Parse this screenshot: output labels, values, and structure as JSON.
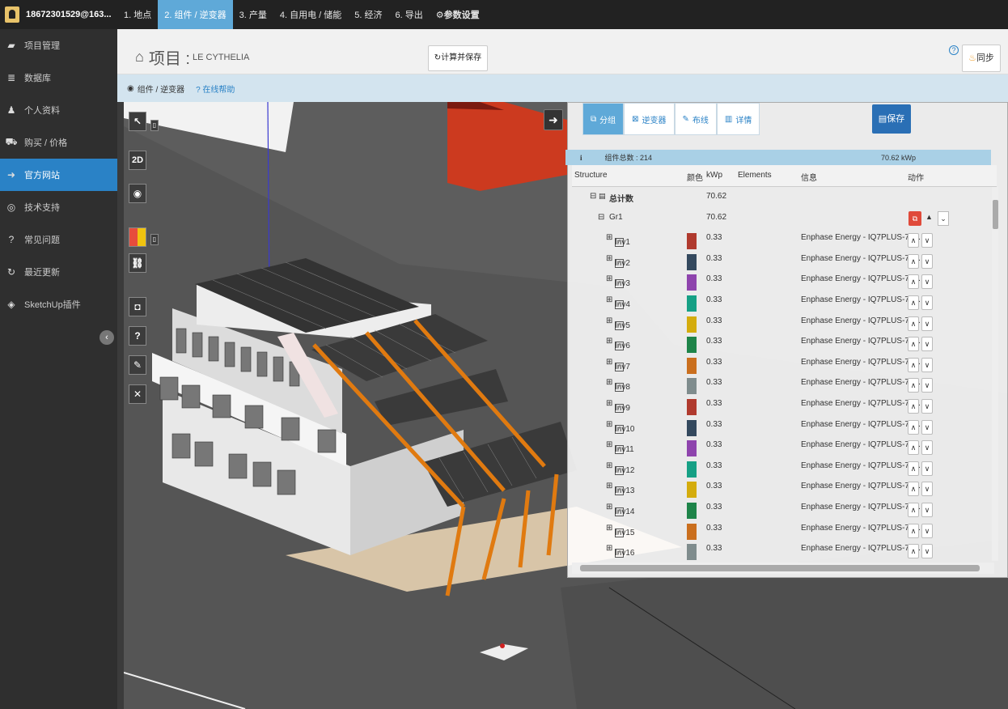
{
  "sidebar": {
    "user": "18672301529@163...",
    "items": [
      {
        "label": "项目管理",
        "icon": "folder-icon",
        "glyph": "▰"
      },
      {
        "label": "数据库",
        "icon": "database-icon",
        "glyph": "≣"
      },
      {
        "label": "个人资料",
        "icon": "user-icon",
        "glyph": "♟"
      },
      {
        "label": "购买 / 价格",
        "icon": "cart-icon",
        "glyph": "⛟"
      },
      {
        "label": "官方网站",
        "icon": "arrow-up-icon",
        "glyph": "➜"
      },
      {
        "label": "技术支持",
        "icon": "lifebuoy-icon",
        "glyph": "◎"
      },
      {
        "label": "常见问题",
        "icon": "question-icon",
        "glyph": "?"
      },
      {
        "label": "最近更新",
        "icon": "refresh-icon",
        "glyph": "↻"
      },
      {
        "label": "SketchUp插件",
        "icon": "sketchup-icon",
        "glyph": "◈"
      }
    ],
    "active_index": 4
  },
  "topnav": {
    "tabs": [
      "1. 地点",
      "2. 组件 / 逆变器",
      "3. 产量",
      "4. 自用电 / 储能",
      "5. 经济",
      "6. 导出",
      "参数设置"
    ],
    "active_index": 1
  },
  "header": {
    "title": "项目 :",
    "project_name": "LE CYTHELIA",
    "calc_button": "计算并保存",
    "help": "?",
    "sync_button": "同步"
  },
  "breadcrumb": {
    "current": "组件 / 逆变器",
    "help_link": "在线帮助"
  },
  "viewer_tools": {
    "two_d": "2D",
    "help": "?"
  },
  "panel": {
    "tabs": [
      "分组",
      "逆变器",
      "布线",
      "详情"
    ],
    "active_tab": 0,
    "save_button": "保存",
    "info": {
      "icon": "i",
      "module_count": "组件总数 : 214",
      "total_power": "70.62 kWp"
    },
    "columns": [
      "Structure",
      "颜色",
      "kWp",
      "Elements",
      "信息",
      "动作"
    ],
    "total": {
      "label": "总计数",
      "kwp": "70.62"
    },
    "group": {
      "label": "Gr1",
      "kwp": "70.62"
    },
    "inverters": [
      {
        "name": "Inv1",
        "color": "#b03a2e",
        "kwp": "0.33",
        "info": "Enphase Energy - IQ7PLUS-72..."
      },
      {
        "name": "Inv2",
        "color": "#34495e",
        "kwp": "0.33",
        "info": "Enphase Energy - IQ7PLUS-72..."
      },
      {
        "name": "Inv3",
        "color": "#8e44ad",
        "kwp": "0.33",
        "info": "Enphase Energy - IQ7PLUS-72..."
      },
      {
        "name": "Inv4",
        "color": "#16a085",
        "kwp": "0.33",
        "info": "Enphase Energy - IQ7PLUS-72..."
      },
      {
        "name": "Inv5",
        "color": "#d4ac0d",
        "kwp": "0.33",
        "info": "Enphase Energy - IQ7PLUS-72..."
      },
      {
        "name": "Inv6",
        "color": "#1e8449",
        "kwp": "0.33",
        "info": "Enphase Energy - IQ7PLUS-72..."
      },
      {
        "name": "Inv7",
        "color": "#ca6f1e",
        "kwp": "0.33",
        "info": "Enphase Energy - IQ7PLUS-72..."
      },
      {
        "name": "Inv8",
        "color": "#7f8c8d",
        "kwp": "0.33",
        "info": "Enphase Energy - IQ7PLUS-72..."
      },
      {
        "name": "Inv9",
        "color": "#b03a2e",
        "kwp": "0.33",
        "info": "Enphase Energy - IQ7PLUS-72..."
      },
      {
        "name": "Inv10",
        "color": "#34495e",
        "kwp": "0.33",
        "info": "Enphase Energy - IQ7PLUS-72..."
      },
      {
        "name": "Inv11",
        "color": "#8e44ad",
        "kwp": "0.33",
        "info": "Enphase Energy - IQ7PLUS-72..."
      },
      {
        "name": "Inv12",
        "color": "#16a085",
        "kwp": "0.33",
        "info": "Enphase Energy - IQ7PLUS-72..."
      },
      {
        "name": "Inv13",
        "color": "#d4ac0d",
        "kwp": "0.33",
        "info": "Enphase Energy - IQ7PLUS-72..."
      },
      {
        "name": "Inv14",
        "color": "#1e8449",
        "kwp": "0.33",
        "info": "Enphase Energy - IQ7PLUS-72..."
      },
      {
        "name": "Inv15",
        "color": "#ca6f1e",
        "kwp": "0.33",
        "info": "Enphase Energy - IQ7PLUS-72..."
      },
      {
        "name": "Inv16",
        "color": "#7f8c8d",
        "kwp": "0.33",
        "info": "Enphase Energy - IQ7PLUS-72..."
      }
    ]
  }
}
